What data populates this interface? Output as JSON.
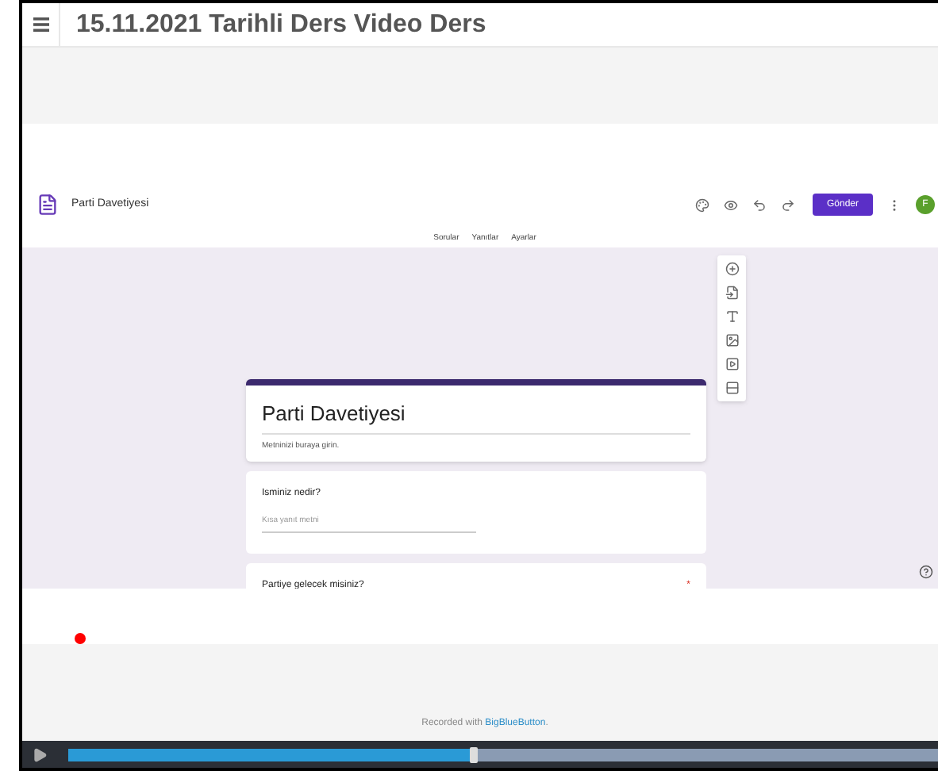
{
  "header": {
    "title": "15.11.2021 Tarihli Ders Video Ders"
  },
  "form_app": {
    "doc_title": "Parti Davetiyesi",
    "send_button": "Gönder",
    "avatar": "F",
    "tabs": [
      {
        "label": "Sorular"
      },
      {
        "label": "Yanıtlar"
      },
      {
        "label": "Ayarlar"
      }
    ],
    "form_title": "Parti Davetiyesi",
    "description": "Metninizi buraya girin.",
    "questions": [
      {
        "title": "Isminiz nedir?",
        "placeholder": "Kısa yanıt metni"
      },
      {
        "title": "Partiye gelecek misiniz?",
        "required_mark": "*"
      }
    ]
  },
  "footer": {
    "text": "Recorded with",
    "link": "BigBlueButton",
    "end": "."
  },
  "player": {
    "level": 0.46
  }
}
